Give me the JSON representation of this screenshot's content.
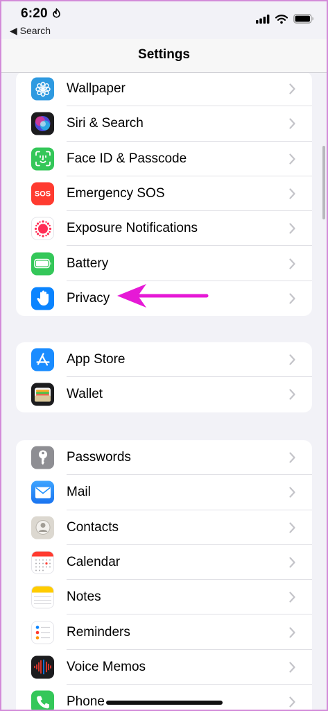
{
  "status_bar": {
    "time": "6:20",
    "back_label": "◀ Search"
  },
  "nav": {
    "title": "Settings"
  },
  "groups": [
    [
      {
        "label": "Wallpaper",
        "icon": "wallpaper-icon",
        "color": "#2f9ae0"
      },
      {
        "label": "Siri & Search",
        "icon": "siri-icon",
        "color": "#1c1c1e"
      },
      {
        "label": "Face ID & Passcode",
        "icon": "face-id-icon",
        "color": "#34c759"
      },
      {
        "label": "Emergency SOS",
        "icon": "sos-icon",
        "color": "#ff3b30",
        "icon_text": "SOS"
      },
      {
        "label": "Exposure Notifications",
        "icon": "exposure-icon",
        "color": "#ffffff"
      },
      {
        "label": "Battery",
        "icon": "battery-icon",
        "color": "#34c759"
      },
      {
        "label": "Privacy",
        "icon": "hand-icon",
        "color": "#0a84ff"
      }
    ],
    [
      {
        "label": "App Store",
        "icon": "app-store-icon",
        "color": "#1a8cff"
      },
      {
        "label": "Wallet",
        "icon": "wallet-icon",
        "color": "#1c1c1e"
      }
    ],
    [
      {
        "label": "Passwords",
        "icon": "key-icon",
        "color": "#8e8e93"
      },
      {
        "label": "Mail",
        "icon": "mail-icon",
        "color": "#1e90ff"
      },
      {
        "label": "Contacts",
        "icon": "contacts-icon",
        "color": "#d8d4cc"
      },
      {
        "label": "Calendar",
        "icon": "calendar-icon",
        "color": "#ffffff"
      },
      {
        "label": "Notes",
        "icon": "notes-icon",
        "color": "#ffffff"
      },
      {
        "label": "Reminders",
        "icon": "reminders-icon",
        "color": "#ffffff"
      },
      {
        "label": "Voice Memos",
        "icon": "voice-memos-icon",
        "color": "#1c1c1e"
      },
      {
        "label": "Phone",
        "icon": "phone-icon",
        "color": "#34c759"
      }
    ]
  ],
  "annotation": {
    "arrow_color": "#e619d6",
    "target": "Privacy"
  }
}
